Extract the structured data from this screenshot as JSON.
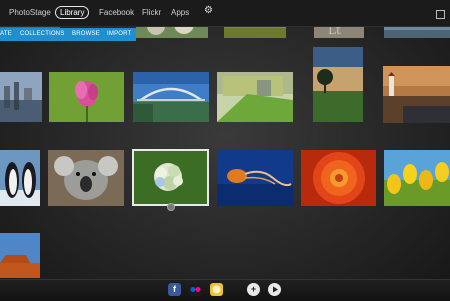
{
  "nav": {
    "items": [
      "PhotoStage",
      "Library",
      "Facebook",
      "Flickr",
      "Apps"
    ],
    "active": "Library"
  },
  "subnav": {
    "items": [
      "ATE",
      "COLLECTIONS",
      "BROWSE",
      "IMPORT"
    ]
  },
  "dock": {
    "icons": [
      "facebook-icon",
      "flickr-icon",
      "photos-app-icon",
      "add-icon",
      "play-icon"
    ]
  },
  "colors": {
    "accent_blue": "#1e8fcf",
    "nav_bg": "#1b1b1b",
    "stage_bg": "#262626"
  },
  "thumbnails": [
    "city-water-partial",
    "tree-flowers",
    "grass-field",
    "graffiti-wall",
    "lake-dock",
    "city-reflection",
    "pink-flower",
    "bridge-river",
    "building-lawn",
    "tree-sunset",
    "lighthouse-shore",
    "penguins",
    "koala",
    "hydrangea",
    "jellyfish",
    "red-dahlia",
    "yellow-tulips",
    "desert-mesa"
  ],
  "selected_thumbnail": "hydrangea"
}
